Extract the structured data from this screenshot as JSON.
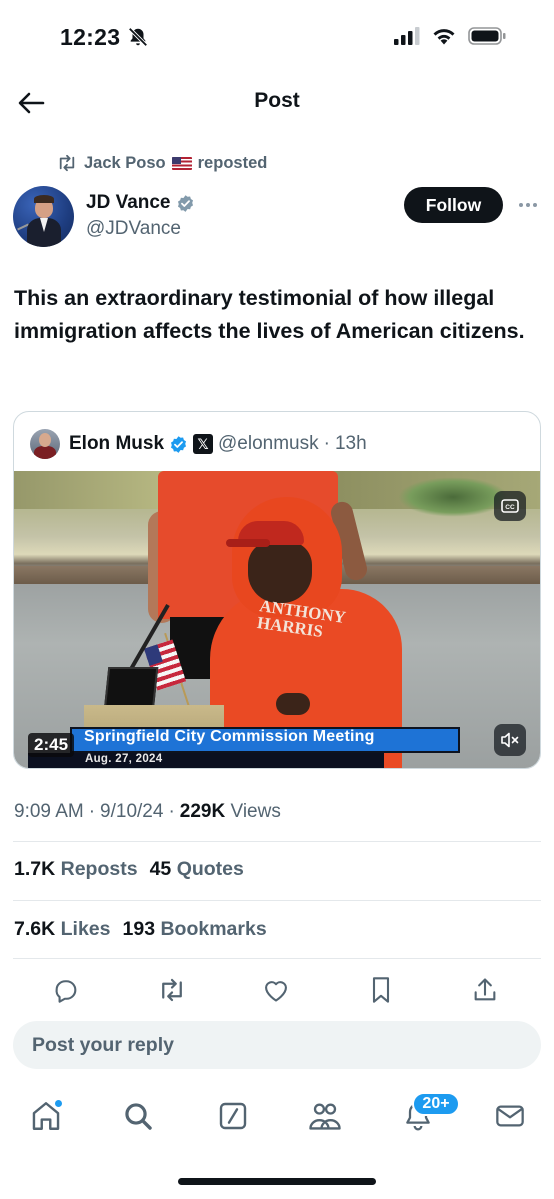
{
  "status_bar": {
    "time": "12:23"
  },
  "header": {
    "title": "Post"
  },
  "repost": {
    "user": "Jack Poso",
    "action": "reposted"
  },
  "author": {
    "name": "JD Vance",
    "handle": "@JDVance"
  },
  "follow_label": "Follow",
  "tweet": {
    "text": "This an extraordinary testimonial of how illegal immigration affects the lives of American citizens."
  },
  "quote": {
    "name": "Elon Musk",
    "x_badge": "𝕏",
    "handle": "@elonmusk",
    "separator": "·",
    "time": "13h",
    "video": {
      "duration": "2:45",
      "caption": "Springfield City Commission Meeting",
      "caption_date": "Aug. 27, 2024",
      "hoodie_text_line1": "ANTHONY",
      "hoodie_text_line2": "HARRIS"
    }
  },
  "meta": {
    "time": "9:09 AM",
    "date": "9/10/24",
    "views_count": "229K",
    "views_label": "Views",
    "sep": "·"
  },
  "stats_row1": {
    "reposts_count": "1.7K",
    "reposts_label": "Reposts",
    "quotes_count": "45",
    "quotes_label": "Quotes"
  },
  "stats_row2": {
    "likes_count": "7.6K",
    "likes_label": "Likes",
    "bookmarks_count": "193",
    "bookmarks_label": "Bookmarks"
  },
  "reply": {
    "placeholder": "Post your reply"
  },
  "tabbar": {
    "notifications_badge": "20+"
  },
  "colors": {
    "accent": "#1d9bf0",
    "text": "#0f1419",
    "secondary": "#536471",
    "follow_bg": "#0f1419"
  }
}
